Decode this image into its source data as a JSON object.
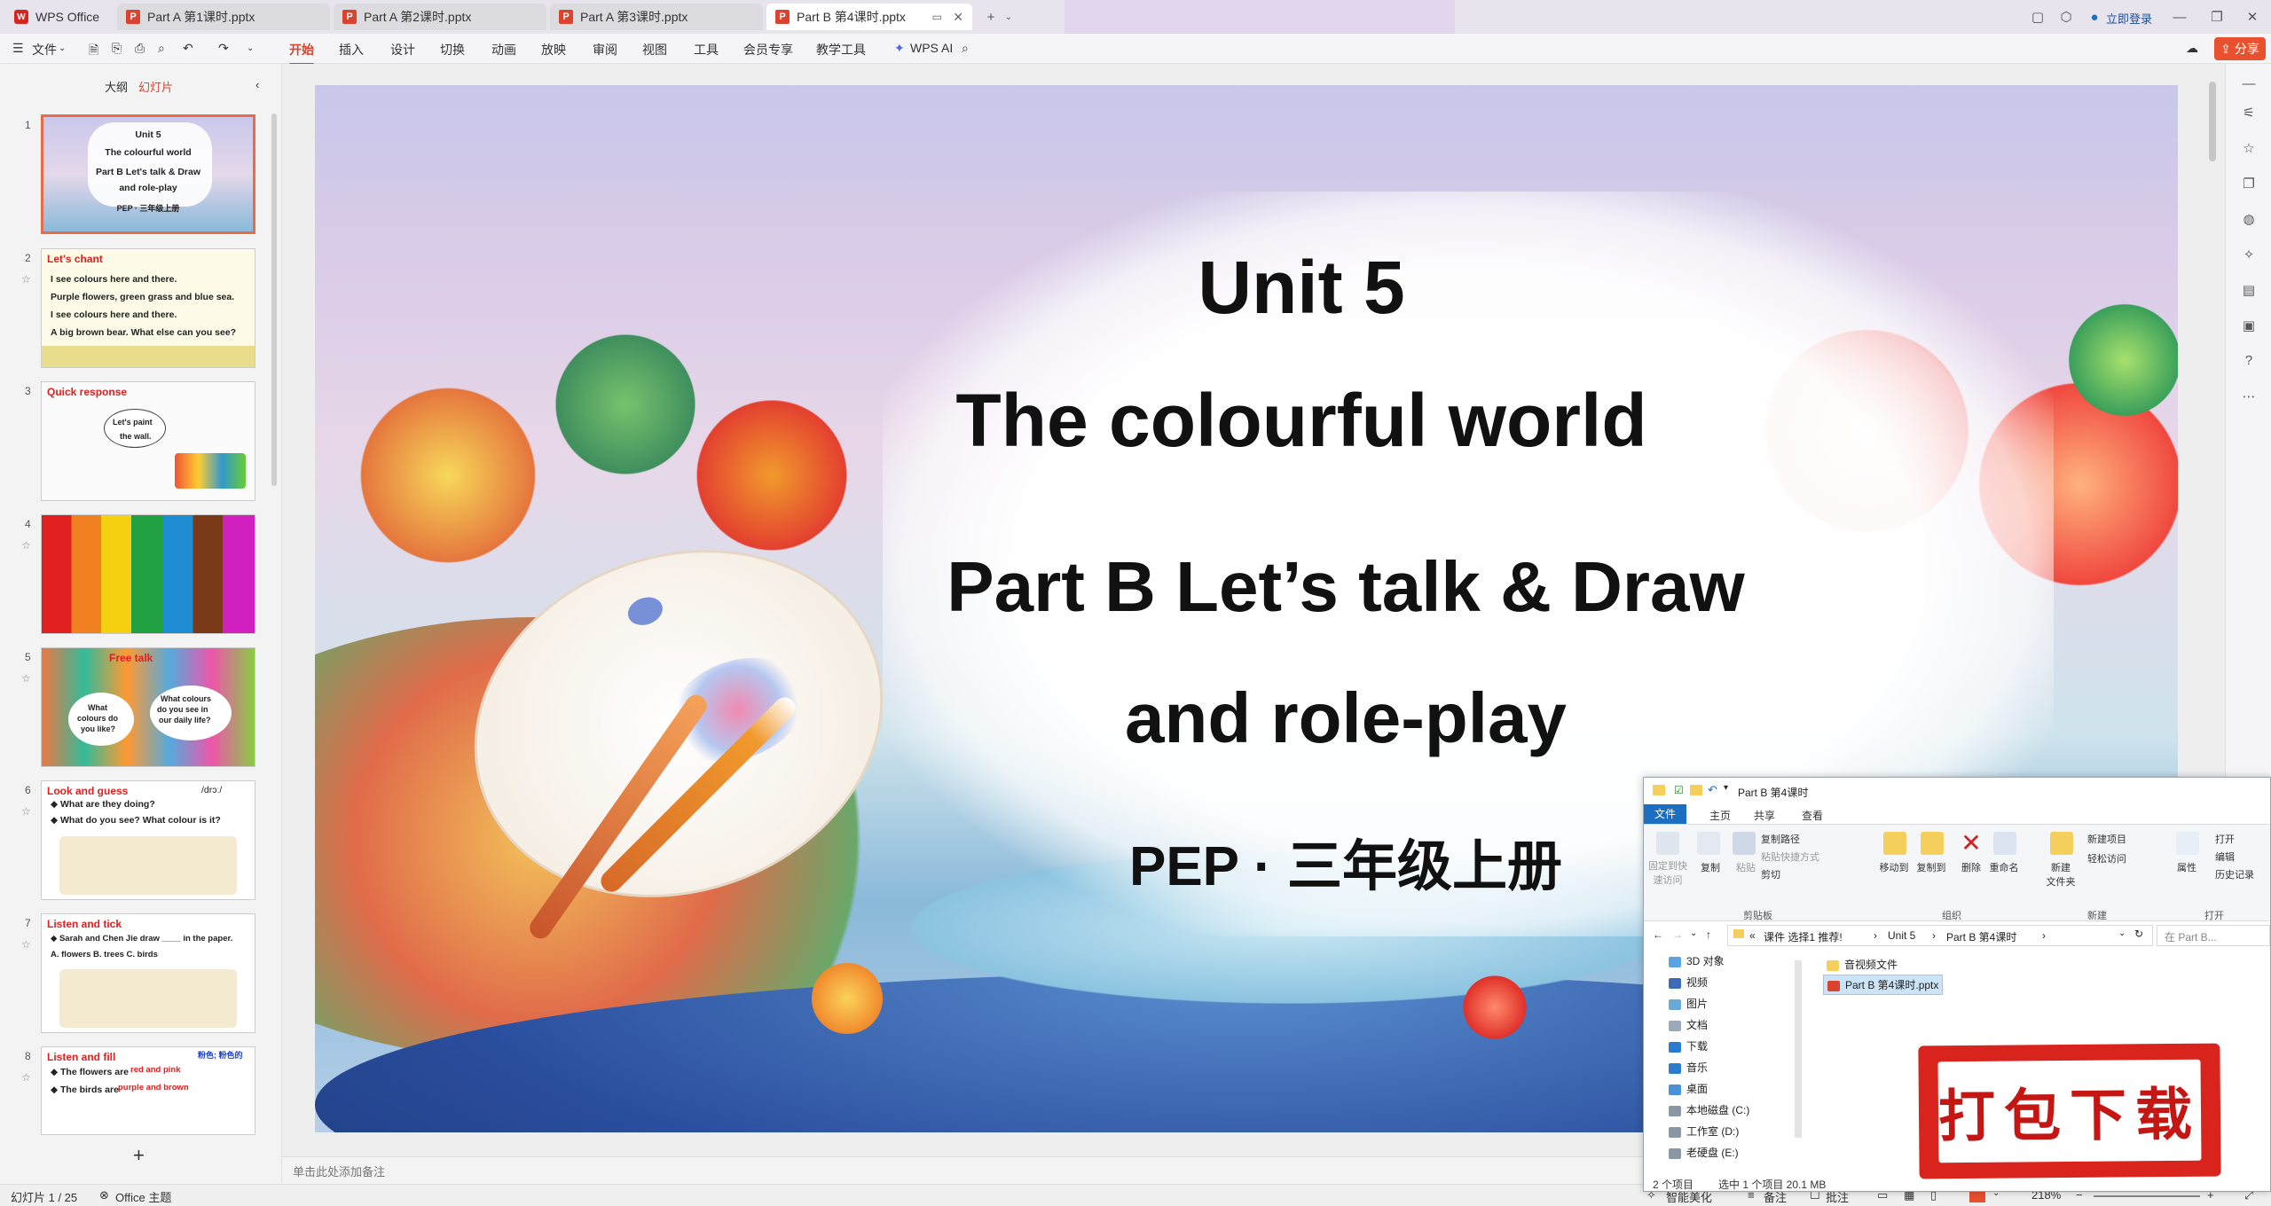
{
  "tabs": [
    {
      "label": "WPS Office",
      "type": "home"
    },
    {
      "label": "Part A 第1课时.pptx"
    },
    {
      "label": "Part A 第2课时.pptx"
    },
    {
      "label": "Part A 第3课时.pptx"
    },
    {
      "label": "Part B 第4课时.pptx",
      "active": true
    }
  ],
  "titlebar": {
    "login_label": "立即登录"
  },
  "menu": {
    "file_label": "文件",
    "items": [
      "开始",
      "插入",
      "设计",
      "切换",
      "动画",
      "放映",
      "审阅",
      "视图",
      "工具",
      "会员专享",
      "教学工具"
    ],
    "active_index": 0,
    "wps_ai_label": "WPS AI",
    "share_label": "分享"
  },
  "left_panel": {
    "tab_outline": "大纲",
    "tab_slides": "幻灯片",
    "slides": [
      {
        "num": "1",
        "lines": [
          "Unit 5",
          "The colourful world",
          "Part B Let's talk & Draw",
          "and role-play",
          "PEP · 三年级上册"
        ]
      },
      {
        "num": "2",
        "title": "Let's chant",
        "lines": [
          "I see colours here and there.",
          "Purple flowers, green grass and blue sea.",
          "I see colours here and there.",
          "A big brown bear. What else can you see?"
        ]
      },
      {
        "num": "3",
        "title": "Quick response",
        "lines": [
          "Let's paint",
          "the wall."
        ]
      },
      {
        "num": "4"
      },
      {
        "num": "5",
        "title": "Free talk",
        "lines": [
          "What",
          "colours do",
          "you like?",
          "What colours",
          "do you see in",
          "our daily life?"
        ]
      },
      {
        "num": "6",
        "title": "Look and guess",
        "lines": [
          "◆ What are they doing?",
          "◆ What do you see? What colour is it?"
        ],
        "extra": "/drɔː/"
      },
      {
        "num": "7",
        "title": "Listen and tick",
        "lines": [
          "◆ Sarah and Chen Jie draw ____ in the paper.",
          "A. flowers      B. trees      C. birds"
        ]
      },
      {
        "num": "8",
        "title": "Listen and fill",
        "lines": [
          "◆ The flowers are",
          "◆ The birds are"
        ],
        "fills": [
          "red and pink",
          "purple and brown"
        ],
        "extra": "粉色; 粉色的"
      }
    ],
    "add_slide_label": "+"
  },
  "slide": {
    "line1": "Unit 5",
    "line2": "The colourful world",
    "line3": "Part B Let’s talk & Draw",
    "line4": "and role-play",
    "line5": "PEP · 三年级上册"
  },
  "notes_placeholder": "单击此处添加备注",
  "status": {
    "slide_counter": "幻灯片 1 / 25",
    "theme": "Office 主题",
    "smart_beautify": "智能美化",
    "notes": "备注",
    "comments": "批注",
    "zoom": "218%"
  },
  "explorer": {
    "title": "Part B 第4课时",
    "ribbon_tabs": [
      "文件",
      "主页",
      "共享",
      "查看"
    ],
    "buttons": {
      "pin": "固定到快速访问",
      "copy": "复制",
      "paste": "粘贴",
      "copy_path": "复制路径",
      "paste_shortcut": "粘贴快捷方式",
      "cut": "剪切",
      "move_to": "移动到",
      "copy_to": "复制到",
      "delete": "删除",
      "rename": "重命名",
      "new_folder": "新建\n文件夹",
      "new_item": "新建项目",
      "easy_access": "轻松访问",
      "properties": "属性",
      "open": "打开",
      "edit": "编辑",
      "history": "历史记录"
    },
    "groups": [
      "剪贴板",
      "组织",
      "新建",
      "打开"
    ],
    "address": [
      "课件 选择1 推荐!",
      "Unit 5",
      "Part B 第4课时"
    ],
    "search_placeholder": "在 Part B...",
    "nav": [
      "3D 对象",
      "视频",
      "图片",
      "文档",
      "下载",
      "音乐",
      "桌面",
      "本地磁盘 (C:)",
      "工作室 (D:)",
      "老硬盘 (E:)"
    ],
    "files": [
      "音视频文件",
      "Part B 第4课时.pptx"
    ],
    "status_items": "2 个项目",
    "status_selected": "选中 1 个项目  20.1 MB"
  },
  "download_badge": "打包下载",
  "colors": {
    "accent": "#d4442f",
    "share": "#e8502e",
    "badge": "#d9231d"
  }
}
